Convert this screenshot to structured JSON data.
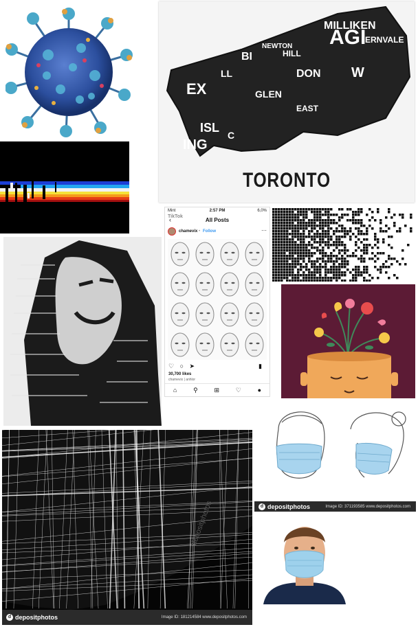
{
  "map_poster": {
    "title": "TORONTO",
    "words": [
      "MILLIKEN",
      "AGI",
      "NEWTON",
      "ERNVALE",
      "DON",
      "EX",
      "GLEN",
      "EAST",
      "ISL",
      "ING",
      "HILL",
      "BI",
      "LL",
      "W",
      "C"
    ]
  },
  "phone": {
    "status_left": "Mint",
    "status_time": "2:57 PM",
    "status_right": "6,0%",
    "watermark": "TikTok",
    "header": "All Posts",
    "username": "chamevix",
    "follow_label": "Follow",
    "likes": "30,700 likes",
    "caption": "chamevix | anhlor"
  },
  "stock_bars": {
    "mask_brand": "depositphotos",
    "mask_meta": "Image ID: 371193585   www.depositphotos.com",
    "streets_brand": "depositphotos",
    "streets_meta": "Image ID: 181214584   www.depositphotos.com",
    "streets_watermark": "depositphotos"
  },
  "colors": {
    "virus_core": "#2c4f9e",
    "virus_spike": "#4aa8c9",
    "poster_bg": "#5c1b35",
    "head_skin": "#f0a85a"
  }
}
